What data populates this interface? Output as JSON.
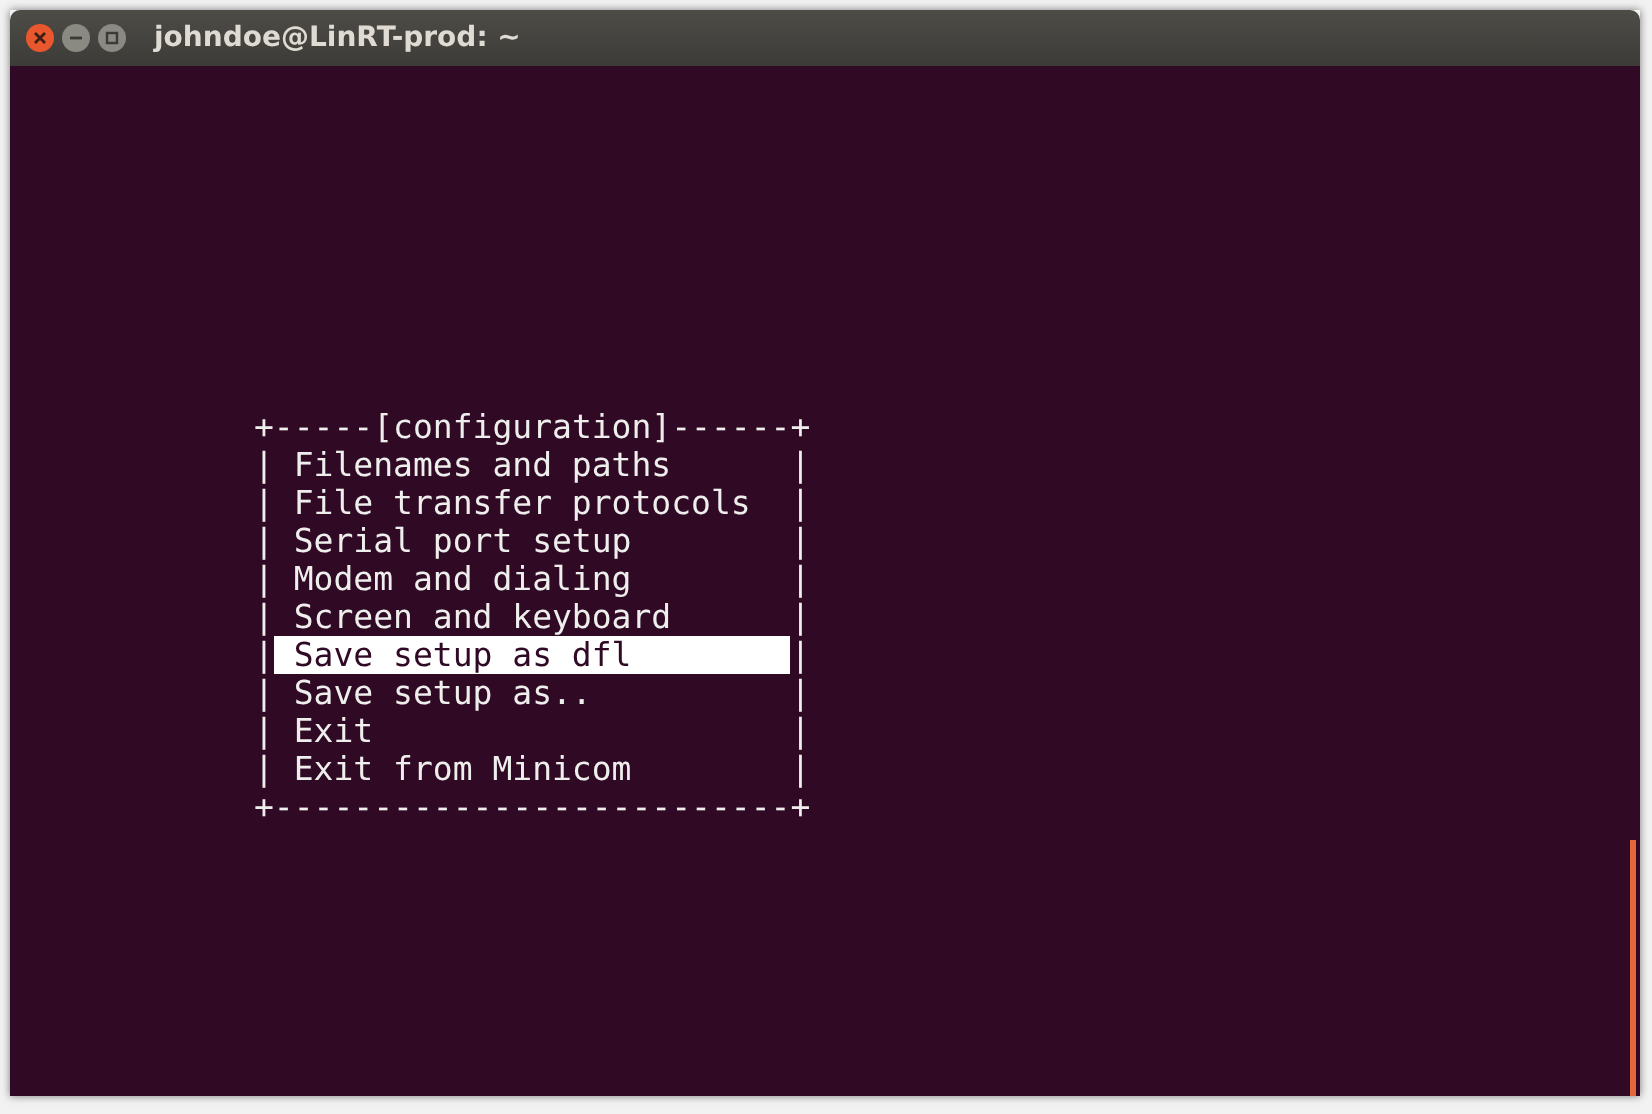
{
  "window": {
    "title": "johndoe@LinRT-prod: ~"
  },
  "menu": {
    "top_border": "+-----[configuration]------+",
    "bottom_border": "+--------------------------+",
    "items": [
      {
        "left": "|",
        "label": "Filenames and paths",
        "right": "|",
        "selected": false
      },
      {
        "left": "|",
        "label": "File transfer protocols",
        "right": "|",
        "selected": false
      },
      {
        "left": "|",
        "label": "Serial port setup",
        "right": "|",
        "selected": false
      },
      {
        "left": "|",
        "label": "Modem and dialing",
        "right": "|",
        "selected": false
      },
      {
        "left": "|",
        "label": "Screen and keyboard",
        "right": "|",
        "selected": false
      },
      {
        "left": "|",
        "label": "Save setup as dfl",
        "right": "|",
        "selected": true
      },
      {
        "left": "|",
        "label": "Save setup as..",
        "right": "|",
        "selected": false
      },
      {
        "left": "|",
        "label": "Exit",
        "right": "|",
        "selected": false
      },
      {
        "left": "|",
        "label": "Exit from Minicom",
        "right": "|",
        "selected": false
      }
    ]
  }
}
